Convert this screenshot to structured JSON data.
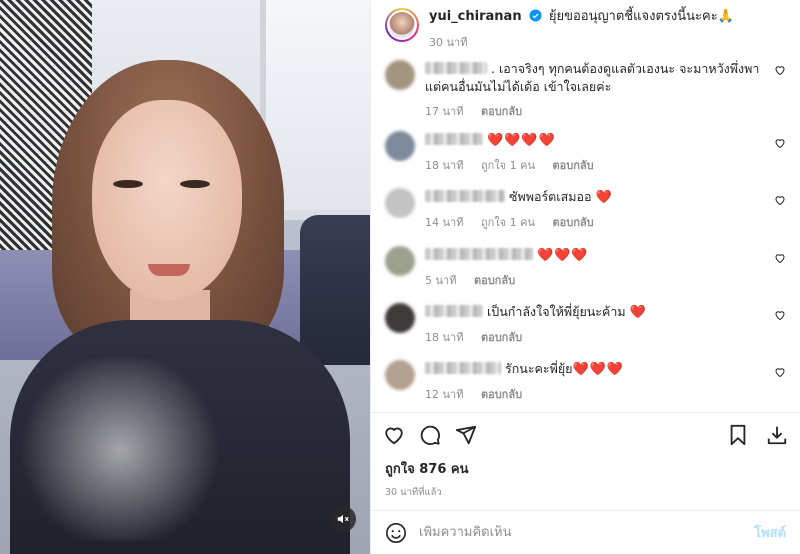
{
  "post": {
    "username": "yui_chiranan",
    "caption": "ยุ้ยขออนุญาตชี้แจงตรงนี้นะคะ🙏",
    "time": "30 นาที"
  },
  "comments": [
    {
      "name_hint": "",
      "text": ". เอาจริงๆ ทุกคนต้องดูแลตัวเองนะ จะมาหวังพึ่งพาแต่คนอื่นมันไม่ได้เด้อ เข้าใจเลยค่ะ",
      "hearts": "",
      "time": "17 นาที",
      "likes": "",
      "reply": "ตอบกลับ",
      "avatar_color": "#a49581"
    },
    {
      "name_hint": "",
      "text": "",
      "hearts": "❤️❤️❤️❤️",
      "time": "18 นาที",
      "likes": "ถูกใจ 1 คน",
      "reply": "ตอบกลับ",
      "avatar_color": "#7c8a9c"
    },
    {
      "name_hint": "",
      "text": "ซัพพอร์ตเสมออ",
      "hearts": "❤️",
      "time": "14 นาที",
      "likes": "ถูกใจ 1 คน",
      "reply": "ตอบกลับ",
      "avatar_color": "#c4c4c4"
    },
    {
      "name_hint": "",
      "text": "",
      "hearts": "❤️❤️❤️",
      "time": "5 นาที",
      "likes": "",
      "reply": "ตอบกลับ",
      "avatar_color": "#9da28f"
    },
    {
      "name_hint": "",
      "text": "เป็นกำลังใจให้พี่ยุ้ยนะค้าม",
      "hearts": "❤️",
      "time": "18 นาที",
      "likes": "",
      "reply": "ตอบกลับ",
      "avatar_color": "#3e3a39"
    },
    {
      "name_hint": "",
      "text": "รักนะคะพี่ยุ้ย",
      "hearts": "❤️❤️❤️",
      "time": "12 นาที",
      "likes": "",
      "reply": "ตอบกลับ",
      "avatar_color": "#b3a18f"
    }
  ],
  "footer": {
    "likes": "ถูกใจ 876 คน",
    "ago": "30 นาทีที่แล้ว",
    "comment_placeholder": "เพิ่มความคิดเห็น",
    "post_label": "โพสต์"
  },
  "icons": {
    "like": "heart-outline",
    "comment": "speech-bubble",
    "share": "paper-plane",
    "save": "bookmark",
    "download": "download-arrow",
    "emoji": "smiley",
    "mute": "speaker-muted",
    "verified": "verified-badge"
  },
  "colors": {
    "verified": "#0095f6",
    "heart_emoji": "#ed1c2e",
    "post_disabled": "#b2dffc",
    "secondary_text": "#8e8e8e"
  }
}
